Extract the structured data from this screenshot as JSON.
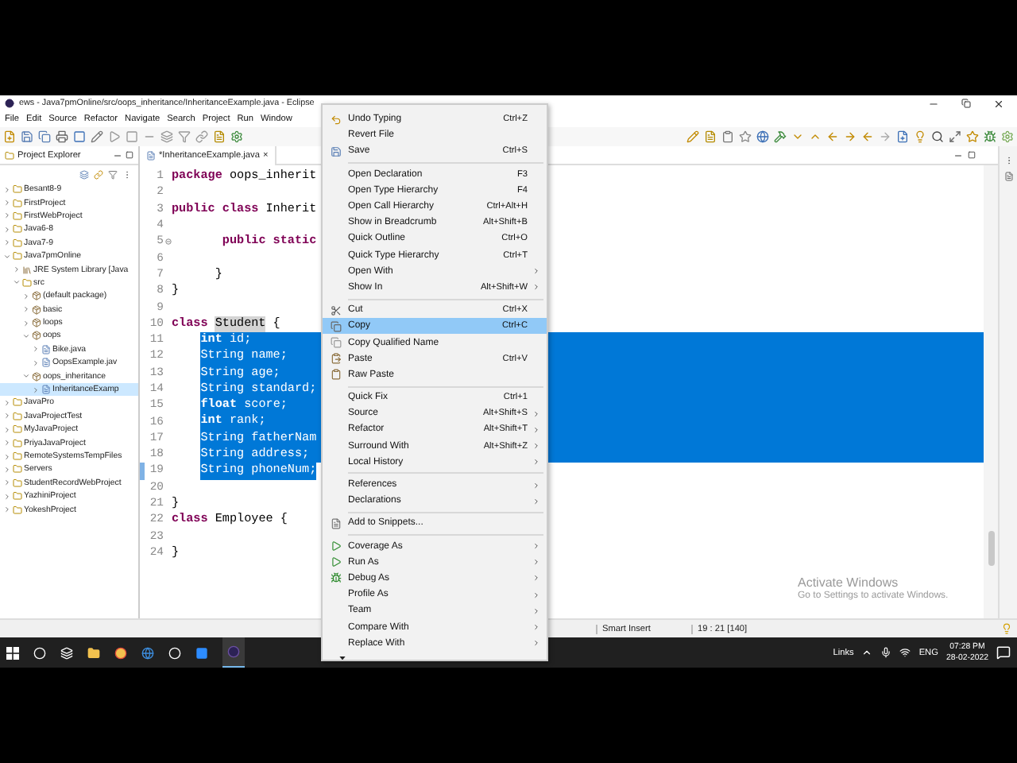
{
  "window": {
    "title": "ews - Java7pmOnline/src/oops_inheritance/InheritanceExample.java - Eclipse"
  },
  "menu_bar": [
    "File",
    "Edit",
    "Source",
    "Refactor",
    "Navigate",
    "Search",
    "Project",
    "Run",
    "Window"
  ],
  "project_explorer": {
    "title": "Project Explorer",
    "tree": [
      {
        "label": "Besant8-9",
        "kind": "project",
        "expanded": false,
        "selected": false
      },
      {
        "label": "FirstProject",
        "kind": "project",
        "expanded": false,
        "selected": false
      },
      {
        "label": "FirstWebProject",
        "kind": "project",
        "expanded": false,
        "selected": false
      },
      {
        "label": "Java6-8",
        "kind": "project",
        "expanded": false,
        "selected": false
      },
      {
        "label": "Java7-9",
        "kind": "project",
        "expanded": false,
        "selected": false
      },
      {
        "label": "Java7pmOnline",
        "kind": "project",
        "expanded": true,
        "selected": false,
        "children": [
          {
            "label": "JRE System Library [Java",
            "kind": "library",
            "expanded": false,
            "selected": false
          },
          {
            "label": "src",
            "kind": "folder",
            "expanded": true,
            "selected": false,
            "children": [
              {
                "label": "(default package)",
                "kind": "package",
                "expanded": false,
                "selected": false
              },
              {
                "label": "basic",
                "kind": "package",
                "expanded": false,
                "selected": false
              },
              {
                "label": "loops",
                "kind": "package",
                "expanded": false,
                "selected": false
              },
              {
                "label": "oops",
                "kind": "package",
                "expanded": true,
                "selected": false,
                "children": [
                  {
                    "label": "Bike.java",
                    "kind": "file",
                    "expanded": false,
                    "selected": false
                  },
                  {
                    "label": "OopsExample.jav",
                    "kind": "file",
                    "expanded": false,
                    "selected": false
                  }
                ]
              },
              {
                "label": "oops_inheritance",
                "kind": "package",
                "expanded": true,
                "selected": false,
                "children": [
                  {
                    "label": "InheritanceExamp",
                    "kind": "file",
                    "expanded": false,
                    "selected": true
                  }
                ]
              }
            ]
          }
        ]
      },
      {
        "label": "JavaPro",
        "kind": "project",
        "expanded": false,
        "selected": false
      },
      {
        "label": "JavaProjectTest",
        "kind": "project",
        "expanded": false,
        "selected": false
      },
      {
        "label": "MyJavaProject",
        "kind": "project",
        "expanded": false,
        "selected": false
      },
      {
        "label": "PriyaJavaProject",
        "kind": "project",
        "expanded": false,
        "selected": false
      },
      {
        "label": "RemoteSystemsTempFiles",
        "kind": "project",
        "expanded": false,
        "selected": false
      },
      {
        "label": "Servers",
        "kind": "project",
        "expanded": false,
        "selected": false
      },
      {
        "label": "StudentRecordWebProject",
        "kind": "project",
        "expanded": false,
        "selected": false
      },
      {
        "label": "YazhiniProject",
        "kind": "project",
        "expanded": false,
        "selected": false
      },
      {
        "label": "YokeshProject",
        "kind": "project",
        "expanded": false,
        "selected": false
      }
    ]
  },
  "editor": {
    "tab": {
      "label": "*InheritanceExample.java",
      "close": "×"
    },
    "lines": [
      {
        "number": "1",
        "segments": [
          {
            "text": "package",
            "kind": "keyword",
            "selected": false
          },
          {
            "text": " oops_inherit",
            "kind": "plain",
            "selected": false
          }
        ]
      },
      {
        "number": "2"
      },
      {
        "number": "3",
        "segments": [
          {
            "text": "public class",
            "kind": "keyword",
            "selected": false
          },
          {
            "text": " Inherit",
            "kind": "plain",
            "selected": false
          }
        ]
      },
      {
        "number": "4"
      },
      {
        "number": "5",
        "fold_marker": true,
        "segments": [
          {
            "text": "       public static",
            "kind": "keyword",
            "selected": false
          }
        ]
      },
      {
        "number": "6"
      },
      {
        "number": "7",
        "segments": [
          {
            "text": "      }",
            "kind": "plain",
            "selected": false
          }
        ]
      },
      {
        "number": "8",
        "segments": [
          {
            "text": "}",
            "kind": "plain",
            "selected": false
          }
        ]
      },
      {
        "number": "9"
      },
      {
        "number": "10",
        "segments": [
          {
            "text": "class ",
            "kind": "keyword",
            "selected": false
          },
          {
            "text": "Student",
            "kind": "occurrence",
            "selected": false
          },
          {
            "text": " {",
            "kind": "plain",
            "selected": false
          }
        ]
      },
      {
        "number": "11",
        "fill_to_end": true,
        "segments": [
          {
            "text": "    int",
            "kind": "keyword",
            "selected": true
          },
          {
            "text": " id;",
            "kind": "plain",
            "selected": true
          }
        ]
      },
      {
        "number": "12",
        "fill_to_end": true,
        "segments": [
          {
            "text": "    String name;",
            "kind": "plain",
            "selected": true
          }
        ]
      },
      {
        "number": "13",
        "fill_to_end": true,
        "segments": [
          {
            "text": "    String age;",
            "kind": "plain",
            "selected": true
          }
        ]
      },
      {
        "number": "14",
        "fill_to_end": true,
        "segments": [
          {
            "text": "    String standard;",
            "kind": "plain",
            "selected": true
          }
        ]
      },
      {
        "number": "15",
        "fill_to_end": true,
        "segments": [
          {
            "text": "    float",
            "kind": "keyword",
            "selected": true
          },
          {
            "text": " score;",
            "kind": "plain",
            "selected": true
          }
        ]
      },
      {
        "number": "16",
        "fill_to_end": true,
        "segments": [
          {
            "text": "    int",
            "kind": "keyword",
            "selected": true
          },
          {
            "text": " rank;",
            "kind": "plain",
            "selected": true
          }
        ]
      },
      {
        "number": "17",
        "fill_to_end": true,
        "segments": [
          {
            "text": "    String fatherNam",
            "kind": "plain",
            "selected": true
          }
        ]
      },
      {
        "number": "18",
        "fill_to_end": true,
        "segments": [
          {
            "text": "    String address;",
            "kind": "plain",
            "selected": true
          }
        ]
      },
      {
        "number": "19",
        "changed": true,
        "segments": [
          {
            "text": "    String phoneNum;",
            "kind": "plain",
            "selected": true
          }
        ]
      },
      {
        "number": "20"
      },
      {
        "number": "21",
        "segments": [
          {
            "text": "}",
            "kind": "plain",
            "selected": false
          }
        ]
      },
      {
        "number": "22",
        "segments": [
          {
            "text": "class",
            "kind": "keyword",
            "selected": false
          },
          {
            "text": " Employee {",
            "kind": "plain",
            "selected": false
          }
        ]
      },
      {
        "number": "23"
      },
      {
        "number": "24",
        "segments": [
          {
            "text": "}",
            "kind": "plain",
            "selected": false
          }
        ]
      }
    ]
  },
  "context_menu": [
    {
      "kind": "item",
      "label": "Undo Typing",
      "shortcut": "Ctrl+Z",
      "submenu": false,
      "selected": false
    },
    {
      "kind": "item",
      "label": "Revert File",
      "submenu": false,
      "selected": false
    },
    {
      "kind": "item",
      "label": "Save",
      "shortcut": "Ctrl+S",
      "submenu": false,
      "selected": false
    },
    {
      "kind": "separator"
    },
    {
      "kind": "item",
      "label": "Open Declaration",
      "shortcut": "F3",
      "submenu": false,
      "selected": false
    },
    {
      "kind": "item",
      "label": "Open Type Hierarchy",
      "shortcut": "F4",
      "submenu": false,
      "selected": false
    },
    {
      "kind": "item",
      "label": "Open Call Hierarchy",
      "shortcut": "Ctrl+Alt+H",
      "submenu": false,
      "selected": false
    },
    {
      "kind": "item",
      "label": "Show in Breadcrumb",
      "shortcut": "Alt+Shift+B",
      "submenu": false,
      "selected": false
    },
    {
      "kind": "item",
      "label": "Quick Outline",
      "shortcut": "Ctrl+O",
      "submenu": false,
      "selected": false
    },
    {
      "kind": "item",
      "label": "Quick Type Hierarchy",
      "shortcut": "Ctrl+T",
      "submenu": false,
      "selected": false
    },
    {
      "kind": "item",
      "label": "Open With",
      "submenu": true,
      "selected": false
    },
    {
      "kind": "item",
      "label": "Show In",
      "shortcut": "Alt+Shift+W",
      "submenu": true,
      "selected": false
    },
    {
      "kind": "separator"
    },
    {
      "kind": "item",
      "label": "Cut",
      "shortcut": "Ctrl+X",
      "submenu": false,
      "selected": false
    },
    {
      "kind": "item",
      "label": "Copy",
      "shortcut": "Ctrl+C",
      "submenu": false,
      "selected": true
    },
    {
      "kind": "item",
      "label": "Copy Qualified Name",
      "submenu": false,
      "selected": false
    },
    {
      "kind": "item",
      "label": "Paste",
      "shortcut": "Ctrl+V",
      "submenu": false,
      "selected": false
    },
    {
      "kind": "item",
      "label": "Raw Paste",
      "submenu": false,
      "selected": false
    },
    {
      "kind": "separator"
    },
    {
      "kind": "item",
      "label": "Quick Fix",
      "shortcut": "Ctrl+1",
      "submenu": false,
      "selected": false
    },
    {
      "kind": "item",
      "label": "Source",
      "shortcut": "Alt+Shift+S",
      "submenu": true,
      "selected": false
    },
    {
      "kind": "item",
      "label": "Refactor",
      "shortcut": "Alt+Shift+T",
      "submenu": true,
      "selected": false
    },
    {
      "kind": "item",
      "label": "Surround With",
      "shortcut": "Alt+Shift+Z",
      "submenu": true,
      "selected": false
    },
    {
      "kind": "item",
      "label": "Local History",
      "submenu": true,
      "selected": false
    },
    {
      "kind": "separator"
    },
    {
      "kind": "item",
      "label": "References",
      "submenu": true,
      "selected": false
    },
    {
      "kind": "item",
      "label": "Declarations",
      "submenu": true,
      "selected": false
    },
    {
      "kind": "separator"
    },
    {
      "kind": "item",
      "label": "Add to Snippets...",
      "submenu": false,
      "selected": false
    },
    {
      "kind": "separator"
    },
    {
      "kind": "item",
      "label": "Coverage As",
      "submenu": true,
      "selected": false
    },
    {
      "kind": "item",
      "label": "Run As",
      "submenu": true,
      "selected": false
    },
    {
      "kind": "item",
      "label": "Debug As",
      "submenu": true,
      "selected": false
    },
    {
      "kind": "item",
      "label": "Profile As",
      "submenu": true,
      "selected": false
    },
    {
      "kind": "item",
      "label": "Team",
      "submenu": true,
      "selected": false
    },
    {
      "kind": "item",
      "label": "Compare With",
      "submenu": true,
      "selected": false
    },
    {
      "kind": "item",
      "label": "Replace With",
      "submenu": true,
      "selected": false
    }
  ],
  "status_bar": [
    "Smart Insert",
    "19 : 21 [140]"
  ],
  "activation_notice": {
    "title": "Activate Windows",
    "text": "Go to Settings to activate Windows."
  },
  "taskbar": {
    "links": "Links",
    "language": "ENG",
    "time": "07:28 PM",
    "date": "28-02-2022"
  }
}
